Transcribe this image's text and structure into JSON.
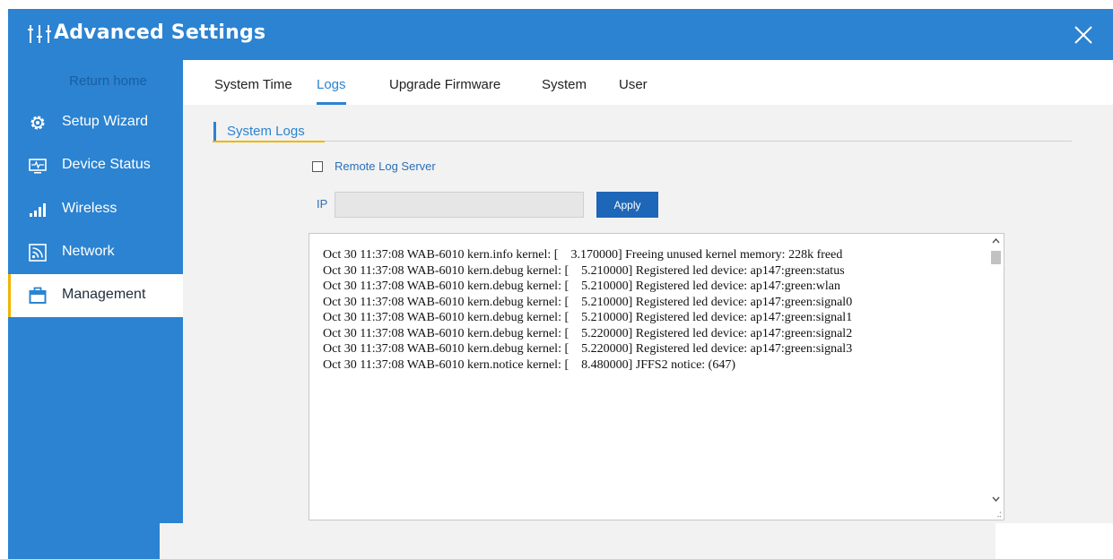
{
  "window": {
    "title": "Advanced Settings",
    "logo_icon": "sliders-icon",
    "close_icon": "close-icon"
  },
  "colors": {
    "brand_blue": "#2b83d1",
    "accent_yellow": "#f0b400",
    "button_blue": "#1e66b7",
    "content_bg": "#f2f2f2"
  },
  "sidebar": {
    "return_home": "Return home",
    "items": [
      {
        "label": "Setup Wizard",
        "icon": "gear-icon",
        "active": false
      },
      {
        "label": "Device Status",
        "icon": "monitor-pulse-icon",
        "active": false
      },
      {
        "label": "Wireless",
        "icon": "signal-bars-icon",
        "active": false
      },
      {
        "label": "Network",
        "icon": "rss-icon",
        "active": false
      },
      {
        "label": "Management",
        "icon": "briefcase-icon",
        "active": true
      }
    ]
  },
  "tabs": [
    {
      "label": "System Time",
      "active": false
    },
    {
      "label": "Logs",
      "active": true
    },
    {
      "label": "Upgrade Firmware",
      "active": false
    },
    {
      "label": "System",
      "active": false
    },
    {
      "label": "User",
      "active": false
    }
  ],
  "section": {
    "title": "System Logs"
  },
  "remote_log": {
    "label": "Remote Log Server",
    "checked": false
  },
  "ip_field": {
    "label": "IP",
    "value": ""
  },
  "apply_button": {
    "label": "Apply"
  },
  "log": {
    "text": "Oct 30 11:37:08 WAB-6010 kern.info kernel: [    3.170000] Freeing unused kernel memory: 228k freed\nOct 30 11:37:08 WAB-6010 kern.debug kernel: [    5.210000] Registered led device: ap147:green:status\nOct 30 11:37:08 WAB-6010 kern.debug kernel: [    5.210000] Registered led device: ap147:green:wlan\nOct 30 11:37:08 WAB-6010 kern.debug kernel: [    5.210000] Registered led device: ap147:green:signal0\nOct 30 11:37:08 WAB-6010 kern.debug kernel: [    5.210000] Registered led device: ap147:green:signal1\nOct 30 11:37:08 WAB-6010 kern.debug kernel: [    5.220000] Registered led device: ap147:green:signal2\nOct 30 11:37:08 WAB-6010 kern.debug kernel: [    5.220000] Registered led device: ap147:green:signal3\nOct 30 11:37:08 WAB-6010 kern.notice kernel: [    8.480000] JFFS2 notice: (647)"
  }
}
